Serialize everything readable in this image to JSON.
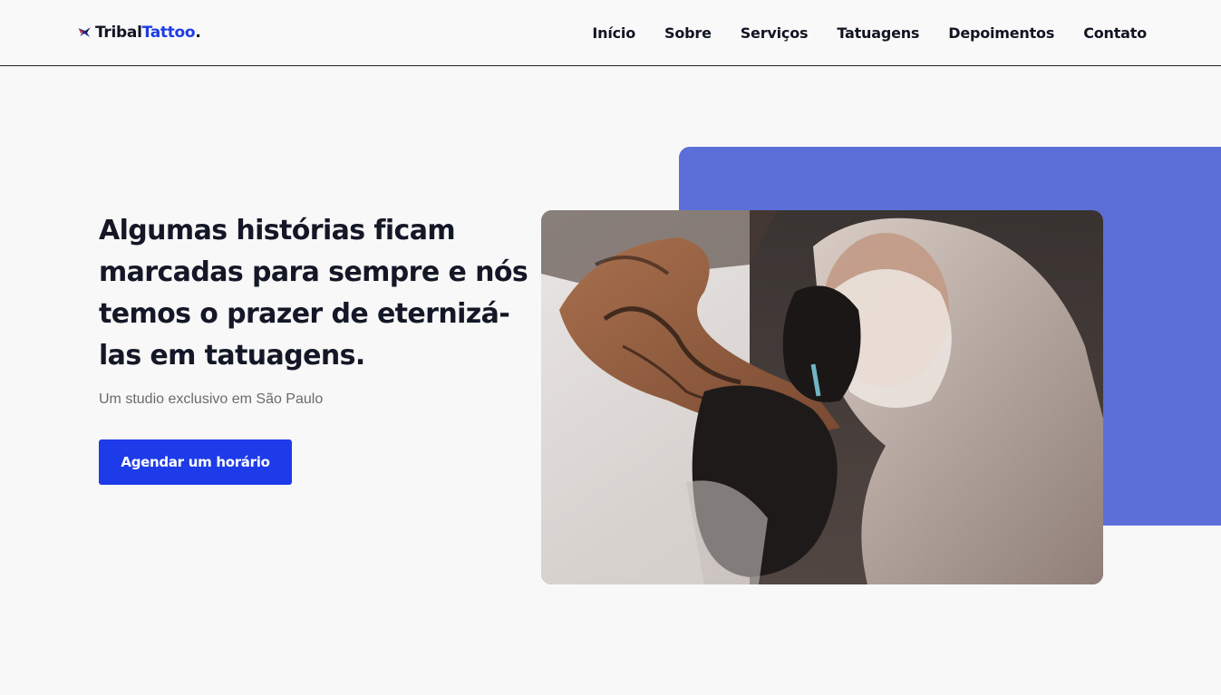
{
  "brand": {
    "name_part1": "Tribal",
    "name_part2": "Tattoo",
    "name_dot": ".",
    "icon": "tribal-bird-logo",
    "colors": {
      "dark": "#111522",
      "accent": "#1d3be8"
    }
  },
  "nav": {
    "items": [
      {
        "label": "Início"
      },
      {
        "label": "Sobre"
      },
      {
        "label": "Serviços"
      },
      {
        "label": "Tatuagens"
      },
      {
        "label": "Depoimentos"
      },
      {
        "label": "Contato"
      }
    ]
  },
  "hero": {
    "title": "Algumas histórias ficam marcadas para sempre e nós temos o prazer de eternizá-las em tatuagens.",
    "subtitle": "Um studio exclusivo em São Paulo",
    "cta_label": "Agendar um horário",
    "accent_color": "#5c6fd8",
    "button_color": "#1d3be8"
  }
}
